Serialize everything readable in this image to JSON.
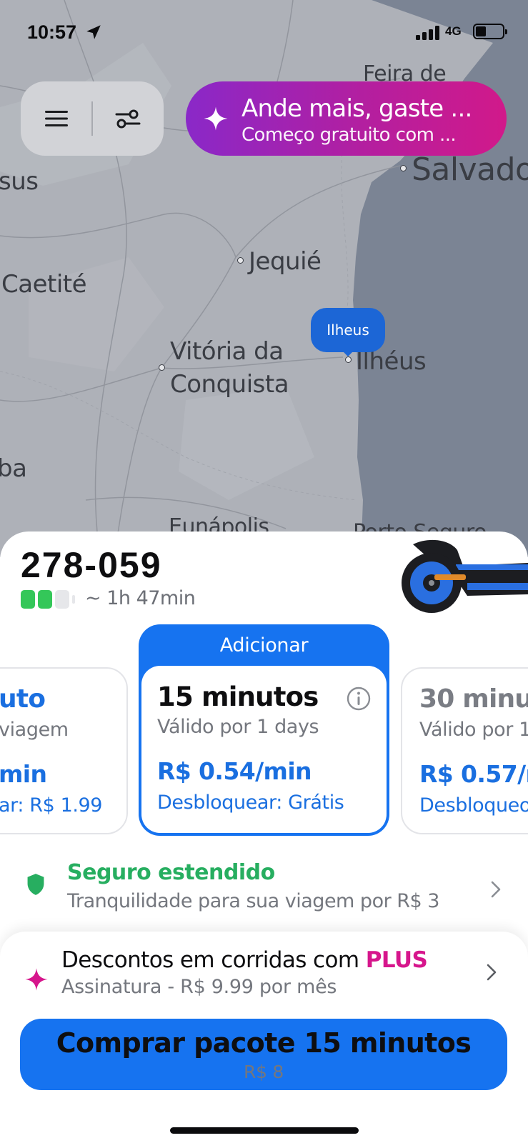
{
  "status_bar": {
    "time": "10:57",
    "network": "4G"
  },
  "map": {
    "places": {
      "feira": "Feira de",
      "salvador": "Salvado",
      "sus": "sus",
      "jequie": "Jequié",
      "caetite": "Caetité",
      "vitoria_1": "Vitória da",
      "vitoria_2": "Conquista",
      "ilheus": "Ilhéus",
      "ba": "ba",
      "eunapolis": "Eunápolis",
      "porto_seguro": "Porto Seguro"
    },
    "pin_label": "Ilheus"
  },
  "top_controls": {
    "menu_icon": "hamburger-icon",
    "filter_icon": "route-filter-icon"
  },
  "promo": {
    "line1": "Ande mais, gaste ...",
    "line2": "Começo gratuito com ..."
  },
  "vehicle": {
    "id": "278-059",
    "range": "~ 1h 47min",
    "battery_level": 0.5
  },
  "plans": {
    "left": {
      "title": "uto",
      "valid": "viagem",
      "price": "min",
      "unlock": "ar: R$ 1.99"
    },
    "selected": {
      "header": "Adicionar",
      "title": "15 minutos",
      "valid": "Válido por 1 days",
      "price": "R$ 0.54/min",
      "unlock": "Desbloquear: Grátis"
    },
    "right": {
      "title": "30 minu",
      "valid": "Válido por 1",
      "price": "R$ 0.57/m",
      "unlock": "Desbloqueo"
    }
  },
  "insurance": {
    "title": "Seguro estendido",
    "subtitle": "Tranquilidade para sua viagem por R$ 3"
  },
  "plus": {
    "title_prefix": "Descontos em corridas com",
    "title_brand": "PLUS",
    "subtitle": "Assinatura -  R$ 9.99 por mês"
  },
  "buy_button": {
    "label": "Comprar pacote 15 minutos",
    "price": "R$ 8"
  },
  "colors": {
    "accent": "#1673f0",
    "plus": "#d6168c",
    "insurance": "#27ae60"
  }
}
